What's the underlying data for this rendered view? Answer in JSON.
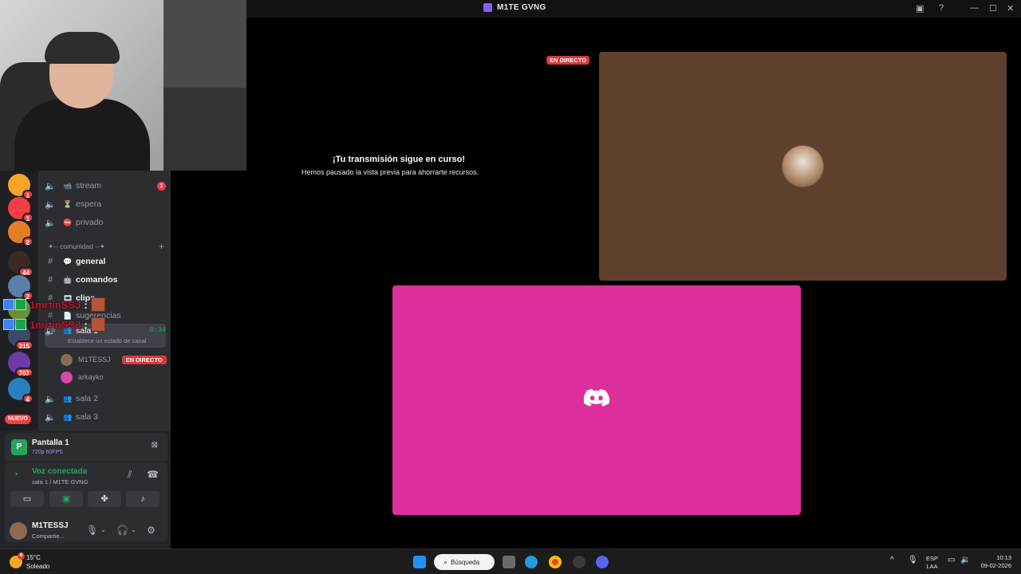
{
  "window": {
    "title": "M1TE GVNG"
  },
  "servers": [
    {
      "badge": "1",
      "color": "#f5a623"
    },
    {
      "badge": "1",
      "color": "#f23f43"
    },
    {
      "badge": "2",
      "color": "#e67e22"
    },
    {
      "badge": "44",
      "color": "#3b2a22"
    },
    {
      "badge": "2",
      "color": "#5a7fa8"
    },
    {
      "badge": "",
      "color": "#6b8f3a"
    },
    {
      "badge": "315",
      "color": "#3a4a6a"
    },
    {
      "badge": "707",
      "color": "#6d3aa8"
    },
    {
      "badge": "4",
      "color": "#2a7fc0"
    }
  ],
  "server_new_label": "NUEVO",
  "channels": {
    "stream": "stream",
    "stream_badge": "1",
    "espera": "espera",
    "privado": "privado",
    "category": "✦-- comunidad --✦",
    "general": "general",
    "comandos": "comandos",
    "clips": "clips",
    "sugerencias": "sugerencias",
    "sala1": "sala 1",
    "sala1_time": "0:34",
    "sala1_status": "Establece un estado de canal",
    "voice_users": [
      {
        "name": "M1TESSJ",
        "live": "EN DIRECTO",
        "avatar_color": "#8b6a55"
      },
      {
        "name": "arkayko",
        "live": "",
        "avatar_color": "#d946a8"
      }
    ],
    "sala2": "sala 2",
    "sala3": "sala 3"
  },
  "chat_overlay": [
    {
      "name": "1mrtinSSJ",
      "colon": ":"
    },
    {
      "name": "1mrtinSSJ",
      "colon": ":"
    }
  ],
  "screen_share": {
    "title": "Pantalla 1",
    "quality": "720p 60FPS"
  },
  "voice_panel": {
    "status": "Voz conectada",
    "location": "sala 1 / M1TE GVNG"
  },
  "user_panel": {
    "name": "M1TESSJ",
    "status": "Compartie..."
  },
  "stage": {
    "paused_title": "¡Tu transmisión sigue en curso!",
    "paused_subtitle": "Hemos pausado la vista previa para ahorrarte recursos.",
    "live_label": "EN DIRECTO",
    "brown_tile_color": "#5e402d",
    "pink_tile_color": "#dc2f9c"
  },
  "taskbar": {
    "weather_badge": "6",
    "weather_temp": "15°C",
    "weather_desc": "Soleado",
    "search_label": "Búsqueda",
    "lang_top": "ESP",
    "lang_bottom": "LAA",
    "time": "10:13",
    "date": "09-02-2026"
  }
}
